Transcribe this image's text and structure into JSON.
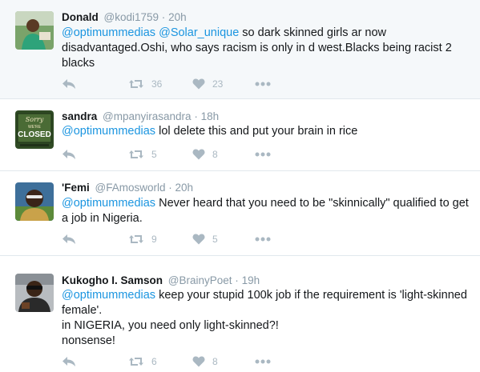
{
  "tweets": [
    {
      "name": "Donald",
      "handle": "@kodi1759",
      "sep": "·",
      "time": "20h",
      "mentions": [
        "@optimummedias",
        "@Solar_unique"
      ],
      "text_lines": [
        " so dark skinned girls ar now",
        "disadvantaged.Oshi, who says racism is only in d west.Blacks being racist 2",
        "blacks"
      ],
      "retweets": "36",
      "likes": "23"
    },
    {
      "name": "sandra",
      "handle": "@mpanyirasandra",
      "sep": "·",
      "time": "18h",
      "mentions": [
        "@optimummedias"
      ],
      "text_lines": [
        " lol delete this and put your brain in rice"
      ],
      "retweets": "5",
      "likes": "8",
      "avatar_sign": {
        "top": "Sorry",
        "mid": "WE'RE",
        "main": "CLOSED"
      }
    },
    {
      "name": "'Femi",
      "handle": "@FAmosworld",
      "sep": "·",
      "time": "20h",
      "mentions": [
        "@optimummedias"
      ],
      "text_lines": [
        " Never heard that you need to be \"skinnically\" qualified to get",
        "a job in Nigeria."
      ],
      "retweets": "9",
      "likes": "5"
    },
    {
      "name": "Kukogho I. Samson",
      "handle": "@BrainyPoet",
      "sep": "·",
      "time": "19h",
      "mentions": [
        "@optimummedias"
      ],
      "text_lines": [
        " keep your stupid 100k job if the requirement is 'light-skinned",
        "female'.",
        "in NIGERIA, you need only light-skinned?!",
        "nonsense!"
      ],
      "retweets": "6",
      "likes": "8"
    }
  ],
  "colors": {
    "link": "#1b95e0",
    "muted": "#8899a6",
    "icon": "#aab8c2",
    "highlight_bg": "#f5f8fa",
    "border": "#e1e8ed"
  },
  "icons": [
    "reply-icon",
    "retweet-icon",
    "like-icon",
    "more-icon"
  ]
}
